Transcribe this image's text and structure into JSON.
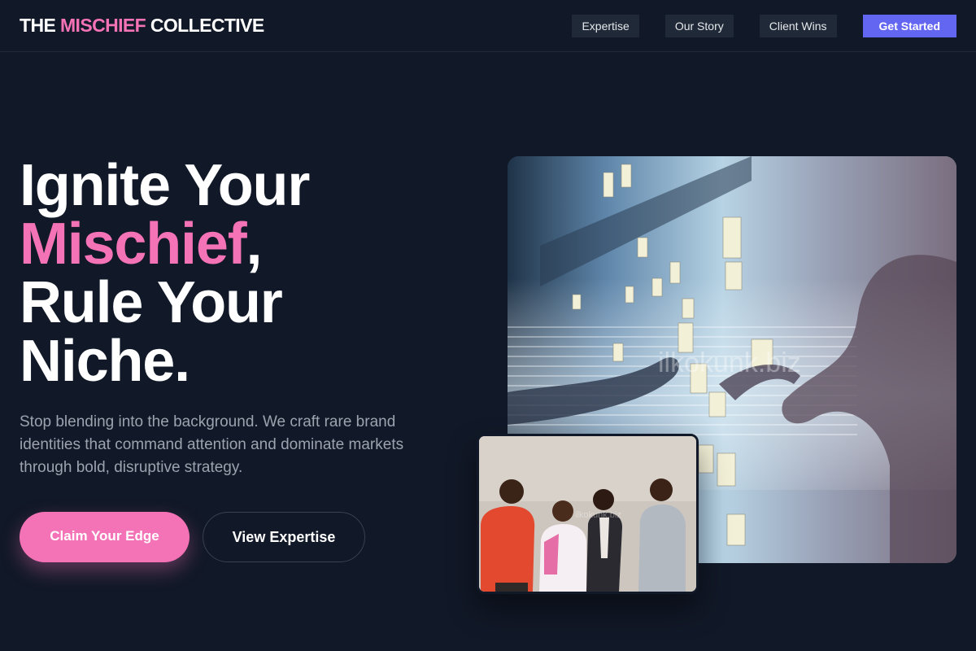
{
  "brand": {
    "prefix": "THE ",
    "highlight": "MISCHIEF",
    "suffix": " COLLECTIVE"
  },
  "nav": {
    "links": [
      "Expertise",
      "Our Story",
      "Client Wins"
    ],
    "cta": "Get Started"
  },
  "hero": {
    "line1": "Ignite Your",
    "accent": "Mischief",
    "accent_punct": ",",
    "line3": "Rule Your",
    "line4": "Niche.",
    "lede": "Stop blending into the background. We craft rare brand identities that command attention and dominate markets through bold, disruptive strategy.",
    "primary_cta": "Claim Your Edge",
    "secondary_cta": "View Expertise"
  },
  "images": {
    "hero_watermark": "ilkokunk.biz",
    "inset_watermark": "ilkokunk.biz"
  },
  "colors": {
    "background": "#111827",
    "accent_pink": "#f472b6",
    "accent_indigo": "#6366f1",
    "muted_text": "#9ca3af"
  }
}
